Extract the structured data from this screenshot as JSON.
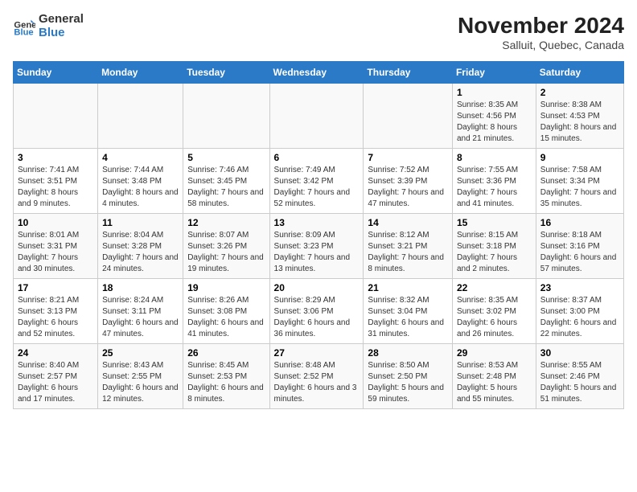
{
  "logo": {
    "line1": "General",
    "line2": "Blue"
  },
  "title": "November 2024",
  "subtitle": "Salluit, Quebec, Canada",
  "days_of_week": [
    "Sunday",
    "Monday",
    "Tuesday",
    "Wednesday",
    "Thursday",
    "Friday",
    "Saturday"
  ],
  "weeks": [
    [
      {
        "day": "",
        "info": ""
      },
      {
        "day": "",
        "info": ""
      },
      {
        "day": "",
        "info": ""
      },
      {
        "day": "",
        "info": ""
      },
      {
        "day": "",
        "info": ""
      },
      {
        "day": "1",
        "info": "Sunrise: 8:35 AM\nSunset: 4:56 PM\nDaylight: 8 hours and 21 minutes."
      },
      {
        "day": "2",
        "info": "Sunrise: 8:38 AM\nSunset: 4:53 PM\nDaylight: 8 hours and 15 minutes."
      }
    ],
    [
      {
        "day": "3",
        "info": "Sunrise: 7:41 AM\nSunset: 3:51 PM\nDaylight: 8 hours and 9 minutes."
      },
      {
        "day": "4",
        "info": "Sunrise: 7:44 AM\nSunset: 3:48 PM\nDaylight: 8 hours and 4 minutes."
      },
      {
        "day": "5",
        "info": "Sunrise: 7:46 AM\nSunset: 3:45 PM\nDaylight: 7 hours and 58 minutes."
      },
      {
        "day": "6",
        "info": "Sunrise: 7:49 AM\nSunset: 3:42 PM\nDaylight: 7 hours and 52 minutes."
      },
      {
        "day": "7",
        "info": "Sunrise: 7:52 AM\nSunset: 3:39 PM\nDaylight: 7 hours and 47 minutes."
      },
      {
        "day": "8",
        "info": "Sunrise: 7:55 AM\nSunset: 3:36 PM\nDaylight: 7 hours and 41 minutes."
      },
      {
        "day": "9",
        "info": "Sunrise: 7:58 AM\nSunset: 3:34 PM\nDaylight: 7 hours and 35 minutes."
      }
    ],
    [
      {
        "day": "10",
        "info": "Sunrise: 8:01 AM\nSunset: 3:31 PM\nDaylight: 7 hours and 30 minutes."
      },
      {
        "day": "11",
        "info": "Sunrise: 8:04 AM\nSunset: 3:28 PM\nDaylight: 7 hours and 24 minutes."
      },
      {
        "day": "12",
        "info": "Sunrise: 8:07 AM\nSunset: 3:26 PM\nDaylight: 7 hours and 19 minutes."
      },
      {
        "day": "13",
        "info": "Sunrise: 8:09 AM\nSunset: 3:23 PM\nDaylight: 7 hours and 13 minutes."
      },
      {
        "day": "14",
        "info": "Sunrise: 8:12 AM\nSunset: 3:21 PM\nDaylight: 7 hours and 8 minutes."
      },
      {
        "day": "15",
        "info": "Sunrise: 8:15 AM\nSunset: 3:18 PM\nDaylight: 7 hours and 2 minutes."
      },
      {
        "day": "16",
        "info": "Sunrise: 8:18 AM\nSunset: 3:16 PM\nDaylight: 6 hours and 57 minutes."
      }
    ],
    [
      {
        "day": "17",
        "info": "Sunrise: 8:21 AM\nSunset: 3:13 PM\nDaylight: 6 hours and 52 minutes."
      },
      {
        "day": "18",
        "info": "Sunrise: 8:24 AM\nSunset: 3:11 PM\nDaylight: 6 hours and 47 minutes."
      },
      {
        "day": "19",
        "info": "Sunrise: 8:26 AM\nSunset: 3:08 PM\nDaylight: 6 hours and 41 minutes."
      },
      {
        "day": "20",
        "info": "Sunrise: 8:29 AM\nSunset: 3:06 PM\nDaylight: 6 hours and 36 minutes."
      },
      {
        "day": "21",
        "info": "Sunrise: 8:32 AM\nSunset: 3:04 PM\nDaylight: 6 hours and 31 minutes."
      },
      {
        "day": "22",
        "info": "Sunrise: 8:35 AM\nSunset: 3:02 PM\nDaylight: 6 hours and 26 minutes."
      },
      {
        "day": "23",
        "info": "Sunrise: 8:37 AM\nSunset: 3:00 PM\nDaylight: 6 hours and 22 minutes."
      }
    ],
    [
      {
        "day": "24",
        "info": "Sunrise: 8:40 AM\nSunset: 2:57 PM\nDaylight: 6 hours and 17 minutes."
      },
      {
        "day": "25",
        "info": "Sunrise: 8:43 AM\nSunset: 2:55 PM\nDaylight: 6 hours and 12 minutes."
      },
      {
        "day": "26",
        "info": "Sunrise: 8:45 AM\nSunset: 2:53 PM\nDaylight: 6 hours and 8 minutes."
      },
      {
        "day": "27",
        "info": "Sunrise: 8:48 AM\nSunset: 2:52 PM\nDaylight: 6 hours and 3 minutes."
      },
      {
        "day": "28",
        "info": "Sunrise: 8:50 AM\nSunset: 2:50 PM\nDaylight: 5 hours and 59 minutes."
      },
      {
        "day": "29",
        "info": "Sunrise: 8:53 AM\nSunset: 2:48 PM\nDaylight: 5 hours and 55 minutes."
      },
      {
        "day": "30",
        "info": "Sunrise: 8:55 AM\nSunset: 2:46 PM\nDaylight: 5 hours and 51 minutes."
      }
    ]
  ]
}
